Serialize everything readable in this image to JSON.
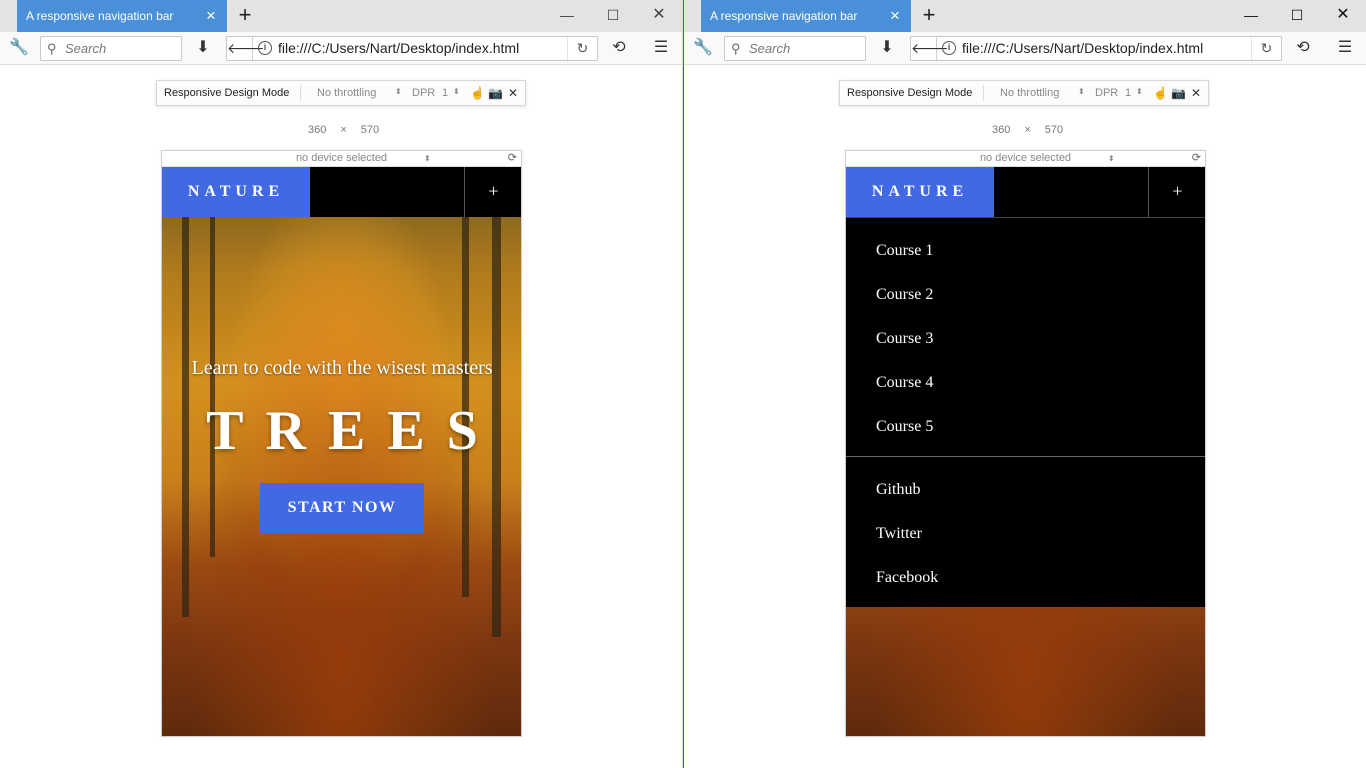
{
  "windows": [
    {
      "tab_title": "A responsive navigation bar",
      "search_placeholder": "Search",
      "url": "file:///C:/Users/Nart/Desktop/index.html",
      "rdm": {
        "mode_label": "Responsive Design Mode",
        "throttling": "No throttling",
        "dpr_label": "DPR",
        "dpr_value": "1",
        "width": "360",
        "times": "×",
        "height": "570",
        "device": "no device selected"
      },
      "site": {
        "logo": "NATURE",
        "toggle": "+",
        "subtitle": "Learn to code with the wisest masters",
        "title": "TREES",
        "cta": "START NOW"
      }
    },
    {
      "tab_title": "A responsive navigation bar",
      "search_placeholder": "Search",
      "url": "file:///C:/Users/Nart/Desktop/index.html",
      "rdm": {
        "mode_label": "Responsive Design Mode",
        "throttling": "No throttling",
        "dpr_label": "DPR",
        "dpr_value": "1",
        "width": "360",
        "times": "×",
        "height": "570",
        "device": "no device selected"
      },
      "site": {
        "logo": "NATURE",
        "toggle": "+",
        "menu_courses": [
          "Course 1",
          "Course 2",
          "Course 3",
          "Course 4",
          "Course 5"
        ],
        "menu_social": [
          "Github",
          "Twitter",
          "Facebook"
        ]
      }
    }
  ],
  "colors": {
    "accent": "#4169e1",
    "tab": "#4a90d9",
    "nav_bg": "#000000"
  }
}
